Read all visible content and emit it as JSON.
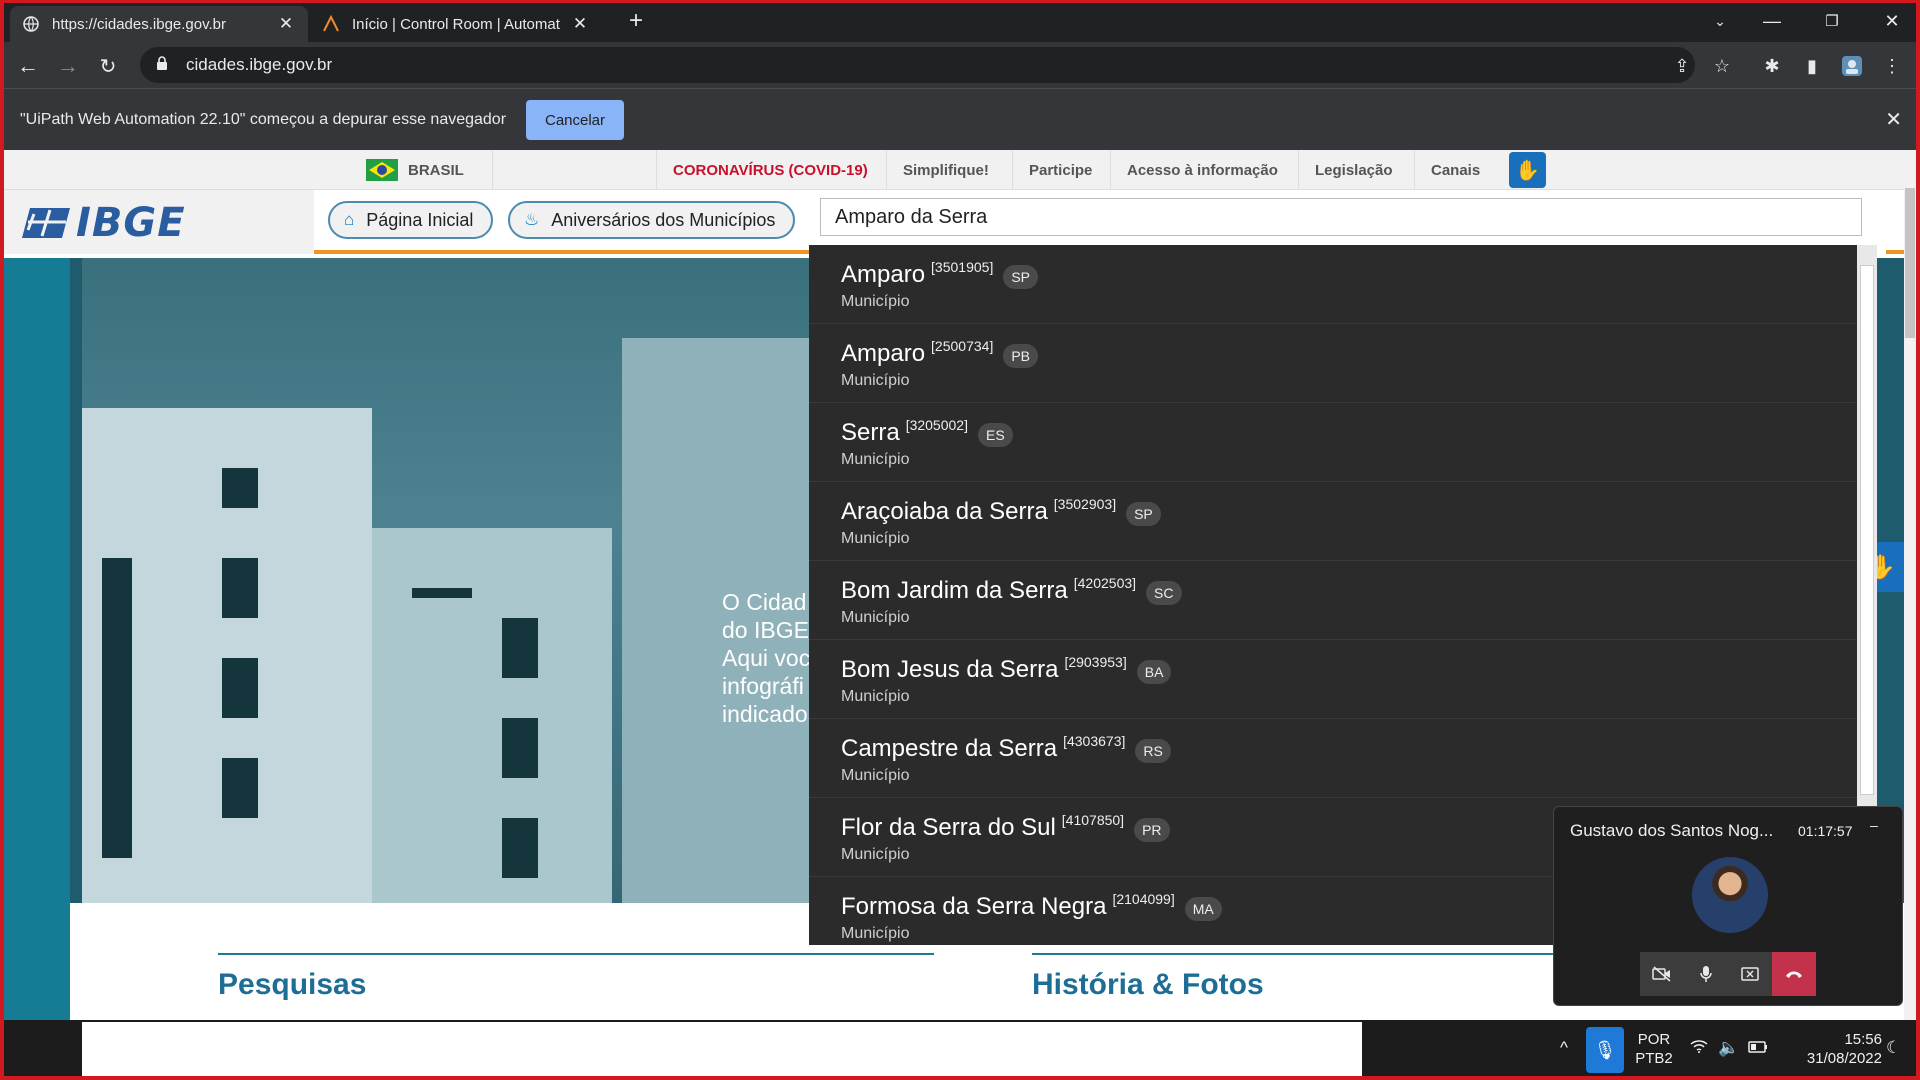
{
  "browser": {
    "tabs": [
      {
        "title": "https://cidades.ibge.gov.br",
        "icon": "globe-icon"
      },
      {
        "title": "Início | Control Room | Automatic",
        "icon": "automation-anywhere-icon"
      }
    ],
    "new_tab": "+",
    "url": "cidades.ibge.gov.br"
  },
  "infobar": {
    "message": "\"UiPath Web Automation 22.10\" começou a depurar esse navegador",
    "cancel_label": "Cancelar"
  },
  "gov_bar": {
    "brasil": "BRASIL",
    "links": [
      "CORONAVÍRUS (COVID-19)",
      "Simplifique!",
      "Participe",
      "Acesso à informação",
      "Legislação",
      "Canais"
    ]
  },
  "header": {
    "logo": "IBGE",
    "nav": [
      "Página Inicial",
      "Aniversários dos Municípios"
    ]
  },
  "search": {
    "value": "Amparo da Serra",
    "results": [
      {
        "name": "Amparo",
        "code": "[3501905]",
        "uf": "SP",
        "type": "Município"
      },
      {
        "name": "Amparo",
        "code": "[2500734]",
        "uf": "PB",
        "type": "Município"
      },
      {
        "name": "Serra",
        "code": "[3205002]",
        "uf": "ES",
        "type": "Município"
      },
      {
        "name": "Araçoiaba da Serra",
        "code": "[3502903]",
        "uf": "SP",
        "type": "Município"
      },
      {
        "name": "Bom Jardim da Serra",
        "code": "[4202503]",
        "uf": "SC",
        "type": "Município"
      },
      {
        "name": "Bom Jesus da Serra",
        "code": "[2903953]",
        "uf": "BA",
        "type": "Município"
      },
      {
        "name": "Campestre da Serra",
        "code": "[4303673]",
        "uf": "RS",
        "type": "Município"
      },
      {
        "name": "Flor da Serra do Sul",
        "code": "[4107850]",
        "uf": "PR",
        "type": "Município"
      },
      {
        "name": "Formosa da Serra Negra",
        "code": "[2104099]",
        "uf": "MA",
        "type": "Município"
      }
    ]
  },
  "hero": {
    "lines": [
      "O Cidad",
      "do IBGE",
      "Aqui voc",
      "infográfi",
      "indicado"
    ]
  },
  "sections": {
    "pesquisas": "Pesquisas",
    "historia": "História & Fotos"
  },
  "call": {
    "name": "Gustavo dos Santos Nog...",
    "time": "01:17:57",
    "minimize": "–"
  },
  "taskbar": {
    "lang_top": "POR",
    "lang_bottom": "PTB2",
    "time": "15:56",
    "date": "31/08/2022"
  },
  "colors": {
    "accent_orange": "#f19221",
    "ibge_blue": "#2a5d9f",
    "section_blue": "#1d6d96",
    "covid_red": "#c8102e",
    "infobar_button": "#8ab4f8"
  }
}
